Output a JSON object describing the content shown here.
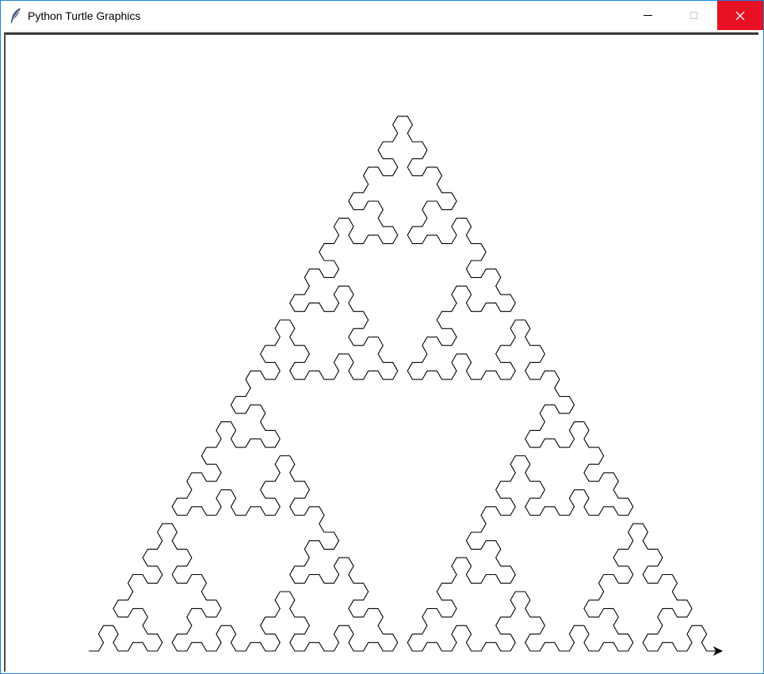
{
  "window": {
    "title": "Python Turtle Graphics",
    "icon": "feather-icon"
  },
  "controls": {
    "minimize_icon": "minimize-icon",
    "maximize_icon": "maximize-icon",
    "close_icon": "close-icon",
    "close_color": "#e81123"
  },
  "canvas": {
    "background": "#ffffff",
    "pen_color": "#000000",
    "figure": "sierpinski-arrowhead-curve",
    "recursion_order": 6,
    "turtle_cursor": "arrow-cursor-icon"
  }
}
